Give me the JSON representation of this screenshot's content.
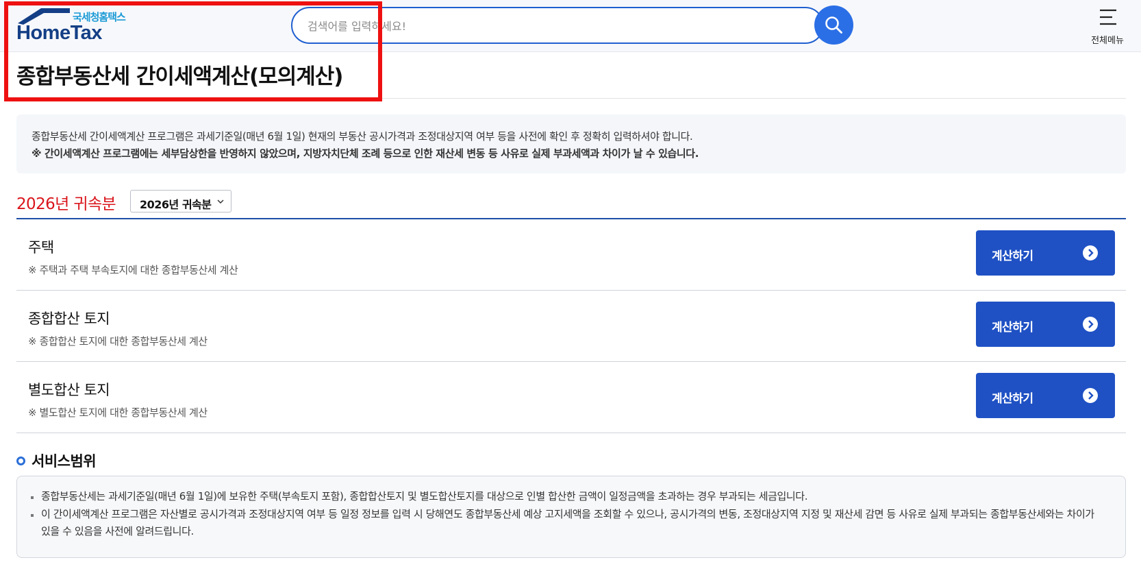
{
  "header": {
    "logo_kr": "국세청홈택스",
    "logo_en": "HomeTax",
    "search_placeholder": "검색어를 입력하세요!",
    "menu_label": "전체메뉴",
    "colors": {
      "brand_navy": "#143f86",
      "brand_cyan": "#1a9ad6",
      "search_accent": "#2b6fe6"
    }
  },
  "page": {
    "title": "종합부동산세 간이세액계산(모의계산)"
  },
  "notice": {
    "line1": "종합부동산세 간이세액계산 프로그램은 과세기준일(매년 6월 1일) 현재의 부동산 공시가격과 조정대상지역 여부 등을 사전에 확인 후 정확히 입력하셔야 합니다.",
    "line2": "※ 간이세액계산 프로그램에는 세부담상한을 반영하지 않았으며, 지방자치단체 조례 등으로 인한 재산세 변동 등 사유로 실제 부과세액과 차이가 날 수 있습니다."
  },
  "year": {
    "label": "2026년 귀속분",
    "selected": "2026년 귀속분",
    "label_color": "#d9151b"
  },
  "rows": [
    {
      "title": "주택",
      "desc": "※ 주택과 주택 부속토지에 대한 종합부동산세 계산",
      "button": "계산하기"
    },
    {
      "title": "종합합산 토지",
      "desc": "※ 종합합산 토지에 대한 종합부동산세 계산",
      "button": "계산하기"
    },
    {
      "title": "별도합산 토지",
      "desc": "※ 별도합산 토지에 대한 종합부동산세 계산",
      "button": "계산하기"
    }
  ],
  "service": {
    "title": "서비스범위",
    "items": [
      "종합부동산세는 과세기준일(매년 6월 1일)에 보유한 주택(부속토지 포함), 종합합산토지 및 별도합산토지를 대상으로 인별 합산한 금액이 일정금액을 초과하는 경우 부과되는 세금입니다.",
      "이 간이세액계산 프로그램은 자산별로 공시가격과 조정대상지역 여부 등 일정 정보를 입력 시 당해연도 종합부동산세 예상 고지세액을 조회할 수 있으나, 공시가격의 변동, 조정대상지역 지정 및 재산세 감면 등 사유로 실제 부과되는 종합부동산세와는 차이가 있을 수 있음을 사전에 알려드립니다."
    ]
  },
  "icons": [
    "home-roof-icon",
    "search-icon",
    "hamburger-menu-icon",
    "chevron-down-icon",
    "chevron-right-circle-icon",
    "ring-bullet-icon"
  ]
}
